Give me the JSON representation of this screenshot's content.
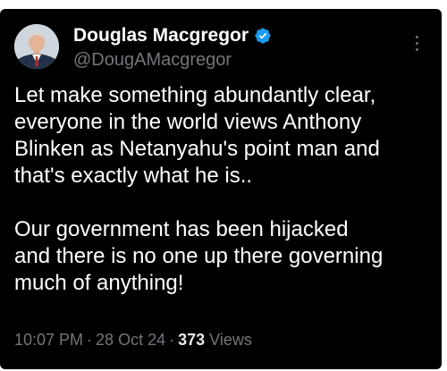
{
  "tweet": {
    "author": {
      "display_name": "Douglas Macgregor",
      "handle": "@DougAMacgregor",
      "verified_icon": "verified-badge-icon",
      "avatar": "profile-photo"
    },
    "text": "Let make something abundantly clear,\neveryone in the world views Anthony\nBlinken as Netanyahu's point man and\nthat's exactly what he is..\n\nOur government has been hijacked\nand there is no one up there governing\nmuch of anything!",
    "time": "10:07 PM",
    "date": "28 Oct 24",
    "separator": "·",
    "views_count": "373",
    "views_label": "Views",
    "more_icon": "more-vertical-icon"
  },
  "colors": {
    "background": "#000000",
    "text_primary": "#ffffff",
    "text_secondary": "#71767b",
    "verified": "#1d9bf0"
  }
}
